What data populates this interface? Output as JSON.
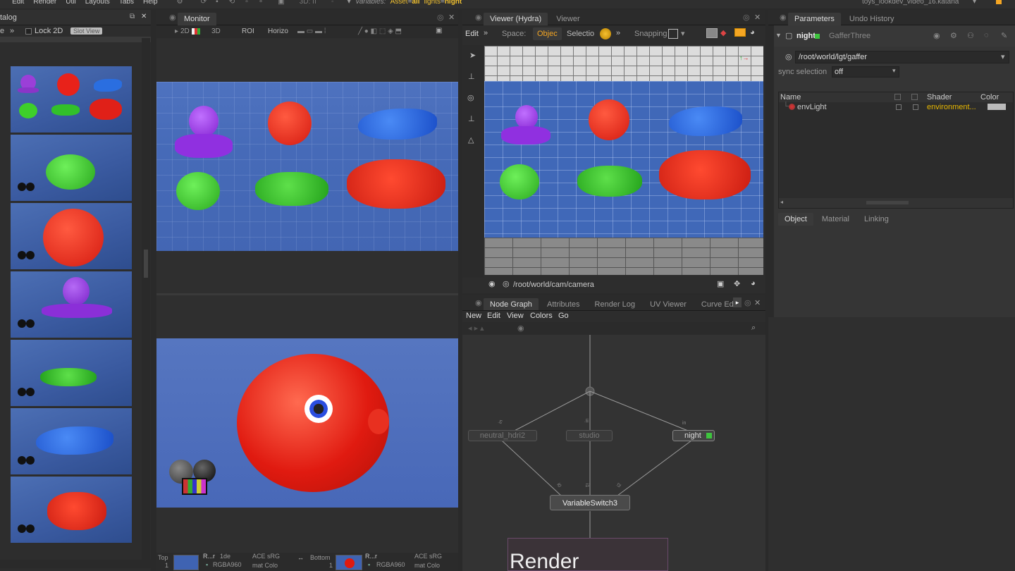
{
  "topbar": {
    "menus": [
      "Edit",
      "Render",
      "Util",
      "Layouts",
      "Tabs",
      "Help"
    ],
    "mode_3d": "3D: ⅠⅠ",
    "variables_label": "variables:",
    "var_asset_key": "Asset",
    "var_asset_val": "all",
    "var_lights_key": "lights",
    "var_lights_val": "night",
    "project_file": "toys_lookdev_video_16.katana"
  },
  "catalog": {
    "title": "talog",
    "toolbar_e": "e",
    "toolbar_more": "»",
    "lock2d_label": "Lock 2D",
    "slot_view_label": "Slot View",
    "thumbnails": [
      "all toys",
      "turtle",
      "pufferfish",
      "octopus",
      "crocodile",
      "shark",
      "crab"
    ]
  },
  "monitor": {
    "tab_label": "Monitor",
    "toolbar": {
      "mode_2d": "2D",
      "mode_3d": "3D",
      "roi": "ROI",
      "horiz": "Horizo"
    },
    "bottom_bar": {
      "top_label": "Top",
      "top_num": "1",
      "top_name": "R...r",
      "top_ide": "1de",
      "top_rgba": "RGBA960",
      "top_aces": "ACE sRG",
      "top_color": "mat Colo",
      "bottom_label": "Bottom",
      "bottom_num": "1",
      "bottom_name": "R...r",
      "bottom_rgba": "RGBA960",
      "bottom_aces": "ACE sRG",
      "bottom_color": "mat Colo"
    }
  },
  "viewer": {
    "tabs": [
      "Viewer (Hydra)",
      "Viewer"
    ],
    "toolbar": {
      "edit": "Edit",
      "more": "»",
      "space_label": "Space:",
      "space_value": "Objec",
      "selection": "Selectio",
      "snapping": "Snapping"
    },
    "camera_path": "/root/world/cam/camera"
  },
  "nodegraph": {
    "tabs": [
      "Node Graph",
      "Attributes",
      "Render Log",
      "UV Viewer",
      "Curve Edit"
    ],
    "menus": [
      "New",
      "Edit",
      "View",
      "Colors",
      "Go"
    ],
    "nodes": {
      "neutral": "neutral_hdri2",
      "studio": "studio",
      "night": "night",
      "switch": "VariableSwitch3",
      "render": "Render"
    },
    "ports": {
      "in1": "in",
      "in2": "in",
      "in3": "in",
      "i0": "i0",
      "i1": "i1",
      "i2": "i2"
    }
  },
  "parameters": {
    "tabs": [
      "Parameters",
      "Undo History"
    ],
    "node_name": "night",
    "node_type": "GafferThree",
    "root_path": "/root/world/lgt/gaffer",
    "sync_label": "sync selection",
    "sync_value": "off",
    "columns": [
      "Name",
      "Shader",
      "Color"
    ],
    "rows": [
      {
        "name": "envLight",
        "shader": "environment..."
      }
    ],
    "subtabs": [
      "Object",
      "Material",
      "Linking"
    ]
  },
  "colors": {
    "accent_orange": "#f5a623",
    "var_yellow": "#f0c030",
    "shader_yellow": "#e8b800",
    "node_green": "#3ec43e",
    "floor_blue": "#4068b8"
  }
}
